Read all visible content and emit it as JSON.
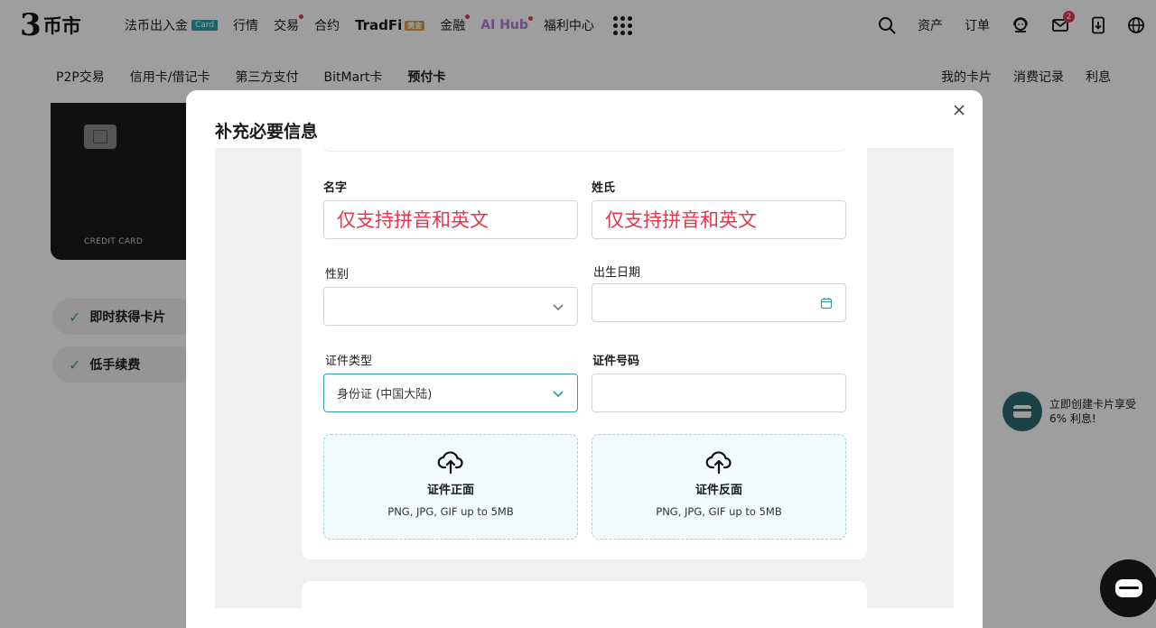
{
  "app": {
    "logo_mark": "3",
    "logo_text": "币市"
  },
  "topnav": {
    "items": [
      {
        "label": "法币出入金",
        "badge": "Card"
      },
      {
        "label": "行情"
      },
      {
        "label": "交易",
        "dot": true
      },
      {
        "label": "合约"
      },
      {
        "label": "TradFi",
        "badge": "黄金"
      },
      {
        "label": "金融",
        "dot": true
      },
      {
        "label": "AI Hub",
        "dot": true
      },
      {
        "label": "福利中心"
      }
    ],
    "right": {
      "assets": "资产",
      "orders": "订单",
      "mail_count": "2"
    }
  },
  "subnav": {
    "items": [
      "P2P交易",
      "信用卡/借记卡",
      "第三方支付",
      "BitMart卡",
      "预付卡"
    ],
    "active": "预付卡",
    "right": [
      "我的卡片",
      "消费记录",
      "利息"
    ]
  },
  "background": {
    "card_label": "CREDIT CARD",
    "features": [
      "即时获得卡片",
      "低手续费"
    ],
    "promo_text": [
      "立即创建卡片享受",
      "6% 利息!"
    ]
  },
  "modal": {
    "title": "补充必要信息",
    "form": {
      "first_name": {
        "label": "名字",
        "placeholder": "仅支持拼音和英文"
      },
      "last_name": {
        "label": "姓氏",
        "placeholder": "仅支持拼音和英文"
      },
      "gender": {
        "label": "性别",
        "value": ""
      },
      "birth_date": {
        "label": "出生日期",
        "value": ""
      },
      "id_type": {
        "label": "证件类型",
        "value": "身份证 (中国大陆)"
      },
      "id_number": {
        "label": "证件号码",
        "value": ""
      },
      "upload_front": {
        "title": "证件正面",
        "hint": "PNG, JPG, GIF up to 5MB"
      },
      "upload_back": {
        "title": "证件反面",
        "hint": "PNG, JPG, GIF up to 5MB"
      }
    }
  },
  "colors": {
    "accent": "#2e9fa8",
    "error": "#e5384c",
    "overlay": "rgba(0,0,0,0.38)"
  }
}
